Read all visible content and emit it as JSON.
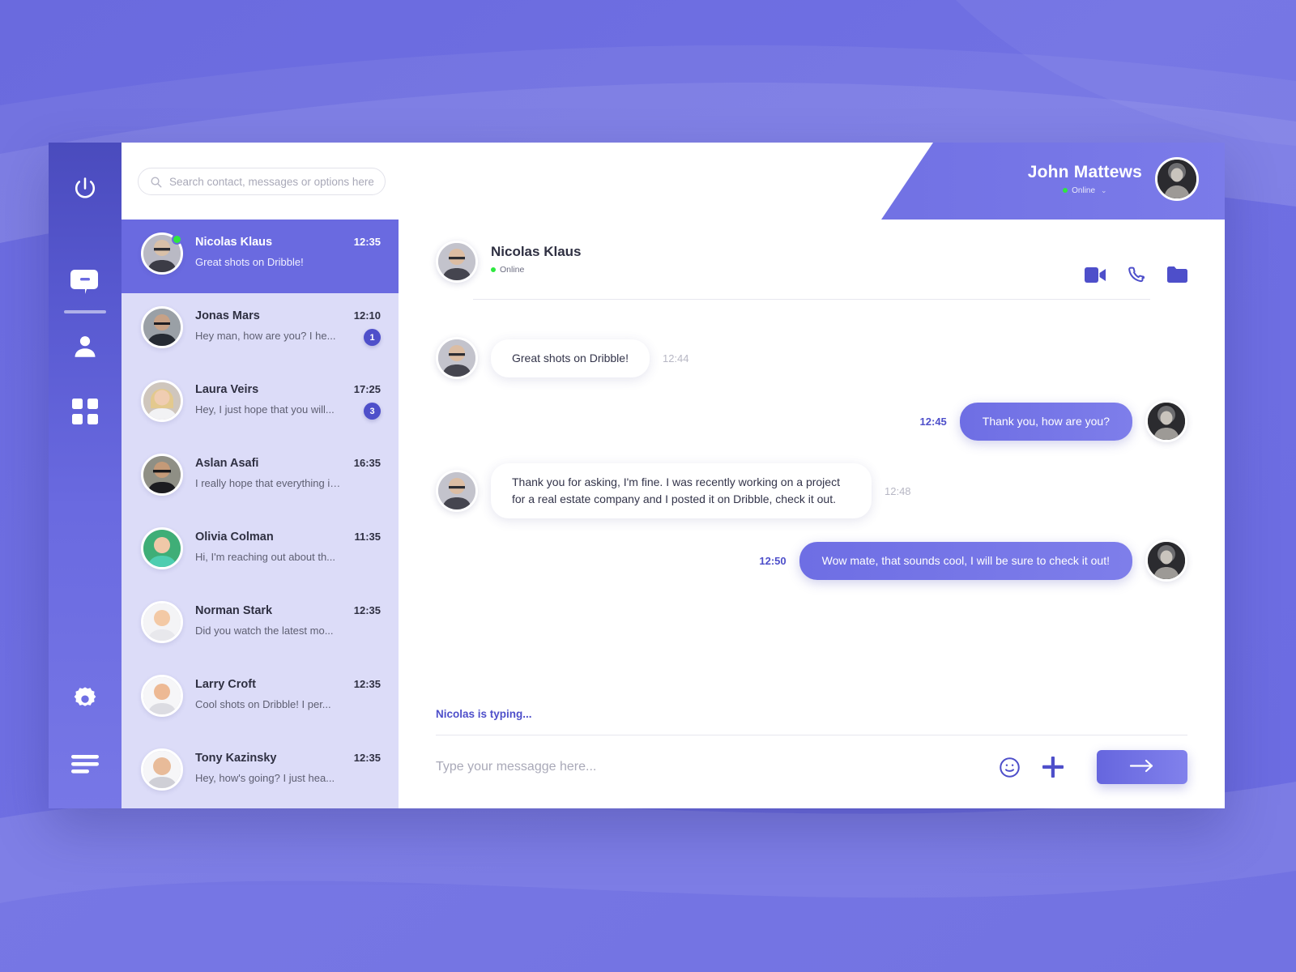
{
  "rail": {
    "items": [
      {
        "name": "power",
        "icon": "power-icon",
        "active": false
      },
      {
        "name": "messages",
        "icon": "chat-bubble-icon",
        "active": true
      },
      {
        "name": "contacts",
        "icon": "person-icon",
        "active": false
      },
      {
        "name": "apps",
        "icon": "grid-icon",
        "active": false
      },
      {
        "name": "settings",
        "icon": "gear-icon",
        "active": false
      },
      {
        "name": "menu",
        "icon": "hamburger-menu-icon",
        "active": false
      }
    ]
  },
  "search": {
    "placeholder": "Search contact, messages or options here.",
    "value": "",
    "icon": "search-icon"
  },
  "profile": {
    "name": "John Mattews",
    "status": "Online",
    "chevron": "⌄",
    "avatar": "user-avatar"
  },
  "contacts": {
    "items": [
      {
        "name": "Nicolas Klaus",
        "preview": "Great shots on Dribble!",
        "time": "12:35",
        "badge": "",
        "online": true,
        "active": true
      },
      {
        "name": "Jonas Mars",
        "preview": "Hey man, how are you? I he...",
        "time": "12:10",
        "badge": "1",
        "online": false,
        "active": false
      },
      {
        "name": "Laura Veirs",
        "preview": "Hey, I just hope that you will...",
        "time": "17:25",
        "badge": "3",
        "online": false,
        "active": false
      },
      {
        "name": "Aslan Asafi",
        "preview": "I really hope that everything is...",
        "time": "16:35",
        "badge": "",
        "online": false,
        "active": false
      },
      {
        "name": "Olivia Colman",
        "preview": "Hi, I'm reaching out about th...",
        "time": "11:35",
        "badge": "",
        "online": false,
        "active": false
      },
      {
        "name": "Norman Stark",
        "preview": "Did you watch the latest mo...",
        "time": "12:35",
        "badge": "",
        "online": false,
        "active": false
      },
      {
        "name": "Larry Croft",
        "preview": "Cool shots on Dribble! I per...",
        "time": "12:35",
        "badge": "",
        "online": false,
        "active": false
      },
      {
        "name": "Tony Kazinsky",
        "preview": "Hey, how's going? I just hea...",
        "time": "12:35",
        "badge": "",
        "online": false,
        "active": false
      }
    ]
  },
  "chat_header": {
    "name": "Nicolas Klaus",
    "status": "Online",
    "actions": [
      {
        "label": "video-call",
        "icon": "video-camera-icon"
      },
      {
        "label": "voice-call",
        "icon": "phone-icon"
      },
      {
        "label": "files",
        "icon": "folder-icon"
      }
    ]
  },
  "messages": [
    {
      "direction": "in",
      "text": "Great shots on Dribble!",
      "time": "12:44"
    },
    {
      "direction": "out",
      "text": "Thank you, how are you?",
      "time": "12:45"
    },
    {
      "direction": "in",
      "text": "Thank you for asking, I'm fine. I was recently working on a project for a real estate company and I posted it on Dribble, check it out.",
      "time": "12:48"
    },
    {
      "direction": "out",
      "text": "Wow mate, that sounds cool, I will be sure to check it out!",
      "time": "12:50"
    }
  ],
  "typing_indicator": "Nicolas is typing...",
  "composer": {
    "placeholder": "Type your messagge here...",
    "value": "",
    "emoji_icon": "smiley-icon",
    "attach_icon": "plus-icon",
    "send_icon": "arrow-right-icon"
  },
  "colors": {
    "accent": "#4e4fca",
    "accent_light": "#6a6ae0",
    "contacts_bg": "#dcdcf8",
    "online": "#2ee83f"
  }
}
